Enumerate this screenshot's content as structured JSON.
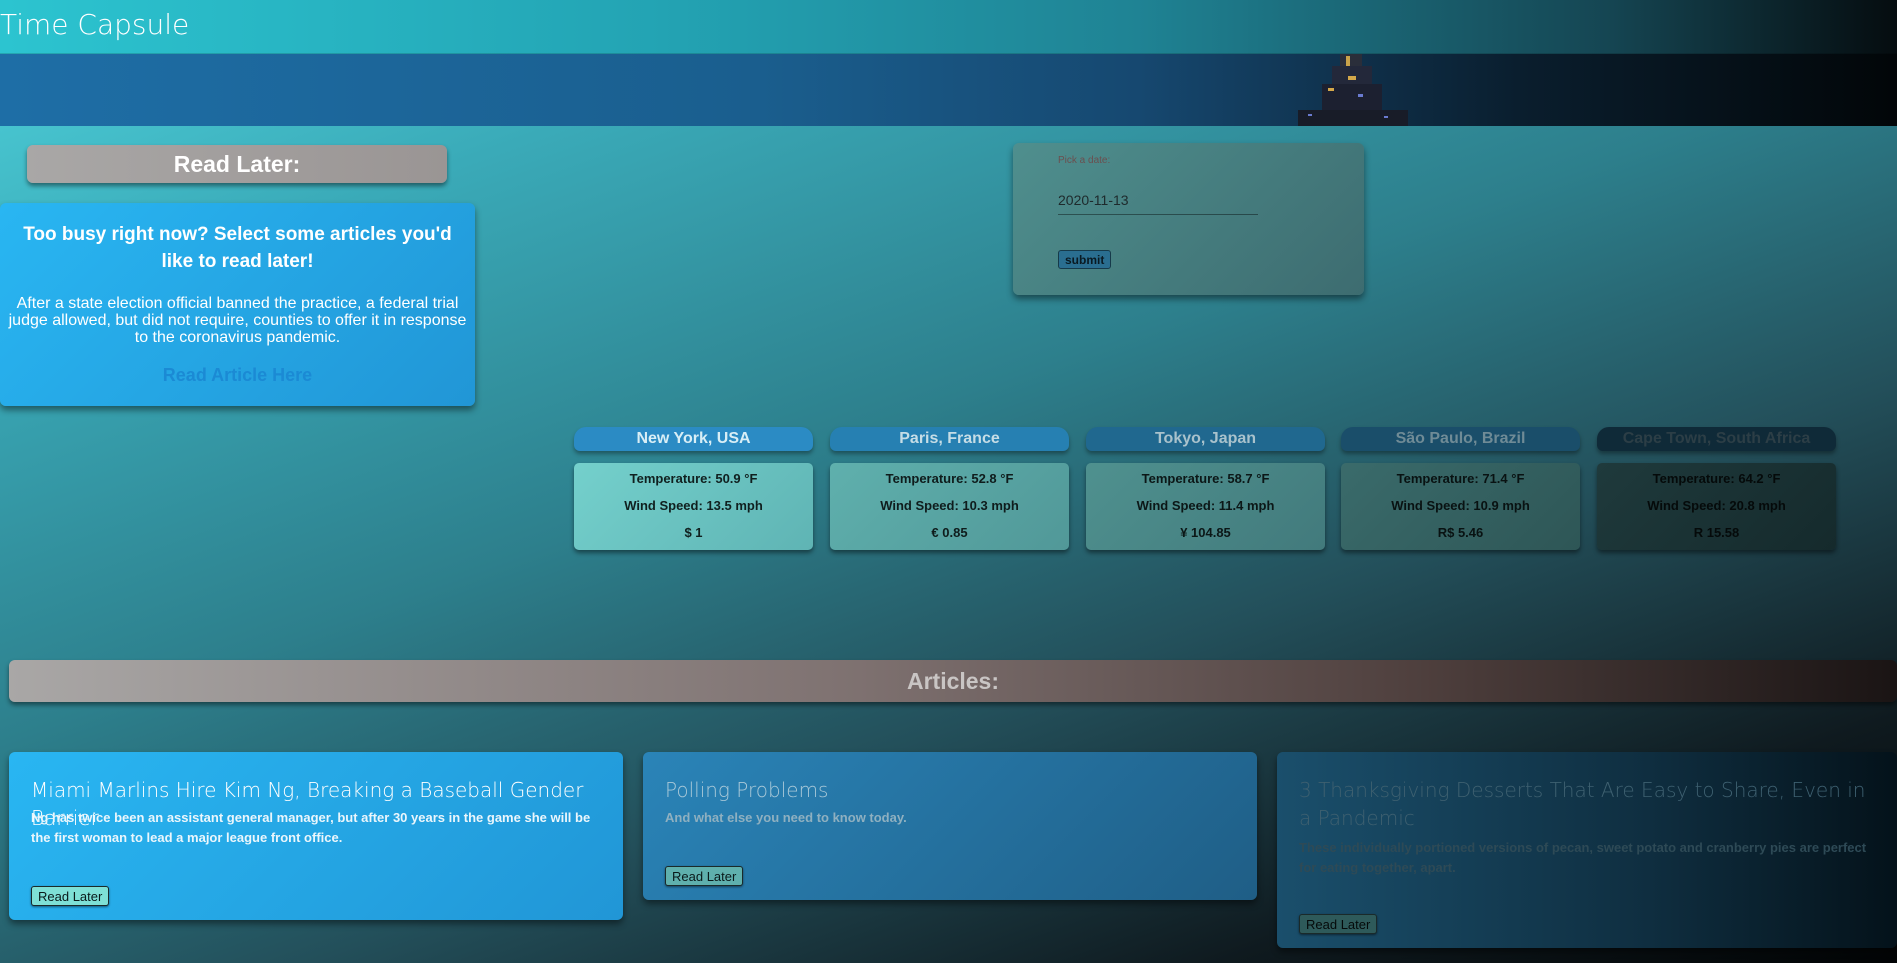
{
  "header": {
    "title": "Time Capsule"
  },
  "read_later": {
    "heading": "Read Later:",
    "card_heading": "Too busy right now? Select some articles you'd like to read later!",
    "card_text": "After a state election official banned the practice, a federal trial judge allowed, but did not require, counties to offer it in response to the coronavirus pandemic.",
    "link_label": "Read Article Here"
  },
  "date_picker": {
    "label": "Pick a date:",
    "value": "2020-11-13",
    "submit_label": "submit"
  },
  "cities": [
    {
      "name": "New York, USA",
      "temperature": "Temperature: 50.9 °F",
      "wind": "Wind Speed: 13.5 mph",
      "currency": "$ 1"
    },
    {
      "name": "Paris, France",
      "temperature": "Temperature: 52.8 °F",
      "wind": "Wind Speed: 10.3 mph",
      "currency": "€ 0.85"
    },
    {
      "name": "Tokyo, Japan",
      "temperature": "Temperature: 58.7 °F",
      "wind": "Wind Speed: 11.4 mph",
      "currency": "¥ 104.85"
    },
    {
      "name": "São Paulo, Brazil",
      "temperature": "Temperature: 71.4 °F",
      "wind": "Wind Speed: 10.9 mph",
      "currency": "R$ 5.46"
    },
    {
      "name": "Cape Town, South Africa",
      "temperature": "Temperature: 64.2 °F",
      "wind": "Wind Speed: 20.8 mph",
      "currency": "R 15.58"
    }
  ],
  "articles_section": {
    "heading": "Articles:"
  },
  "articles": [
    {
      "title": "Miami Marlins Hire Kim Ng, Breaking a Baseball Gender Barrier",
      "summary": "Ng has twice been an assistant general manager, but after 30 years in the game she will be the first woman to lead a major league front office.",
      "button_label": "Read Later"
    },
    {
      "title": "Polling Problems",
      "summary": "And what else you need to know today.",
      "button_label": "Read Later"
    },
    {
      "title": "3 Thanksgiving Desserts That Are Easy to Share, Even in a Pandemic",
      "summary": "These individually portioned versions of pecan, sweet potato and cranberry pies are perfect for eating together, apart.",
      "button_label": "Read Later"
    }
  ]
}
